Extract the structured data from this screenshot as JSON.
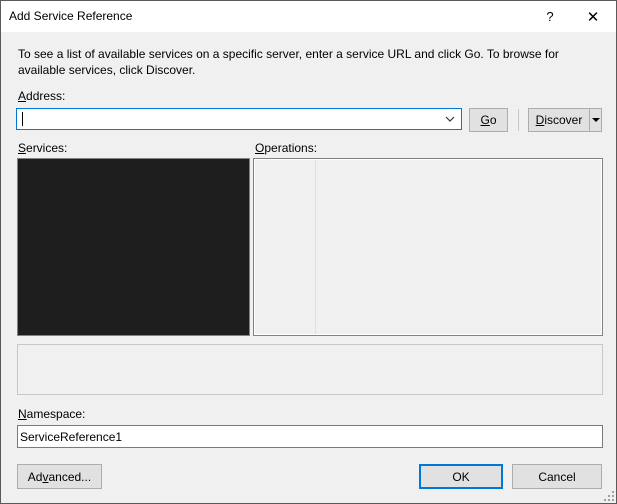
{
  "window": {
    "title": "Add Service Reference",
    "help_glyph": "?",
    "close_glyph": "✕"
  },
  "description": "To see a list of available services on a specific server, enter a service URL and click Go. To browse for available services, click Discover.",
  "address": {
    "label_mnemonic": "A",
    "label_rest": "ddress:",
    "value": ""
  },
  "buttons": {
    "go_mnemonic": "G",
    "go_rest": "o",
    "discover_mnemonic": "D",
    "discover_rest": "iscover",
    "ok": "OK",
    "cancel": "Cancel",
    "advanced_pre": "Ad",
    "advanced_mnemonic": "v",
    "advanced_post": "anced..."
  },
  "services": {
    "label_mnemonic": "S",
    "label_rest": "ervices:"
  },
  "operations": {
    "label_mnemonic": "O",
    "label_rest": "perations:"
  },
  "namespace": {
    "label_mnemonic": "N",
    "label_rest": "amespace:",
    "value": "ServiceReference1"
  },
  "colors": {
    "accent": "#0078d7",
    "services_bg": "#1e1e1e",
    "dialog_bg": "#f0f0f0"
  }
}
